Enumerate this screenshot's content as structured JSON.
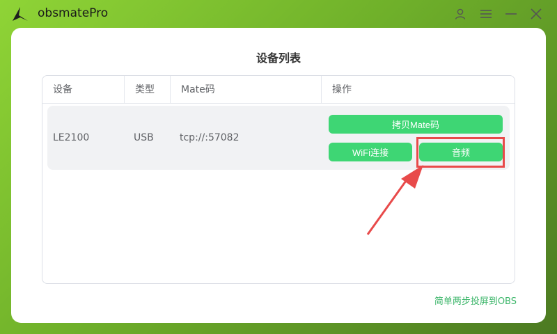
{
  "app": {
    "title": "obsmatePro"
  },
  "page": {
    "title": "设备列表"
  },
  "table": {
    "headers": [
      "设备",
      "类型",
      "Mate码",
      "操作"
    ],
    "rows": [
      {
        "device": "LE2100",
        "type": "USB",
        "mate": "tcp://:57082"
      }
    ]
  },
  "actions": {
    "copy_label": "拷贝Mate码",
    "wifi_label": "WiFi连接",
    "audio_label": "音频"
  },
  "footer": {
    "link": "简单两步投屏到OBS"
  },
  "colors": {
    "accent": "#3ed674",
    "highlight": "#e84a4a",
    "link": "#3cb66a"
  }
}
